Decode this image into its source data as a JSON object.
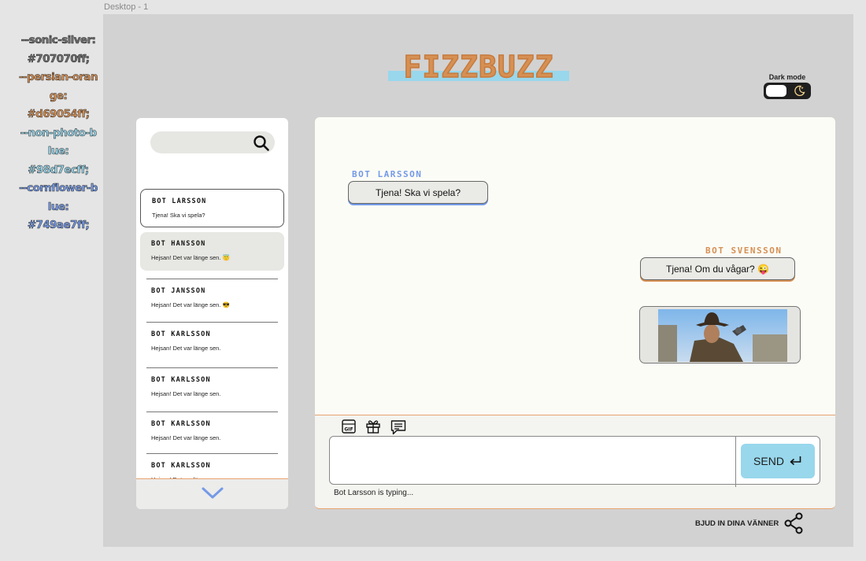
{
  "frame_label": "Desktop - 1",
  "palette": [
    {
      "text": "--sonic-silver:",
      "color": "#707070"
    },
    {
      "text": "#707070ff;",
      "color": "#707070"
    },
    {
      "text": "--persian-oran",
      "color": "#d69054"
    },
    {
      "text": "ge:",
      "color": "#d69054"
    },
    {
      "text": "#d69054ff;",
      "color": "#d69054"
    },
    {
      "text": "--non-photo-b",
      "color": "#98d7ec"
    },
    {
      "text": "lue:",
      "color": "#98d7ec"
    },
    {
      "text": "#98d7ecff;",
      "color": "#98d7ec"
    },
    {
      "text": "--cornflower-b",
      "color": "#749ae7"
    },
    {
      "text": "lue:",
      "color": "#749ae7"
    },
    {
      "text": "#749ae7ff;",
      "color": "#749ae7"
    }
  ],
  "logo": "FIZZBUZZ",
  "dark_mode_label": "Dark mode",
  "search": {
    "placeholder": ""
  },
  "conversations": [
    {
      "name": "BOT LARSSON",
      "message": "Tjena! Ska vi spela?"
    },
    {
      "name": "BOT HANSSON",
      "message": "Hejsan! Det var länge sen. 😇"
    },
    {
      "name": "BOT JANSSON",
      "message": "Hejsan! Det var länge sen. 😎"
    },
    {
      "name": "BOT KARLSSON",
      "message": "Hejsan! Det var länge sen."
    },
    {
      "name": "BOT KARLSSON",
      "message": "Hejsan! Det var länge sen."
    },
    {
      "name": "BOT KARLSSON",
      "message": "Hejsan! Det var länge sen."
    },
    {
      "name": "BOT KARLSSON",
      "message": "Hejsan! Det var länge sen."
    }
  ],
  "chat": {
    "left_sender": "BOT LARSSON",
    "left_message": "Tjena! Ska vi spela?",
    "right_sender": "BOT SVENSSON",
    "right_message": "Tjena! Om du vågar? 😜"
  },
  "composer": {
    "placeholder": "",
    "send_label": "SEND",
    "typing_status": "Bot Larsson is typing..."
  },
  "invite_label": "BJUD IN DINA VÄNNER",
  "colors": {
    "sonic_silver": "#707070",
    "persian_orange": "#d69054",
    "non_photo_blue": "#98d7ec",
    "cornflower_blue": "#749ae7"
  }
}
